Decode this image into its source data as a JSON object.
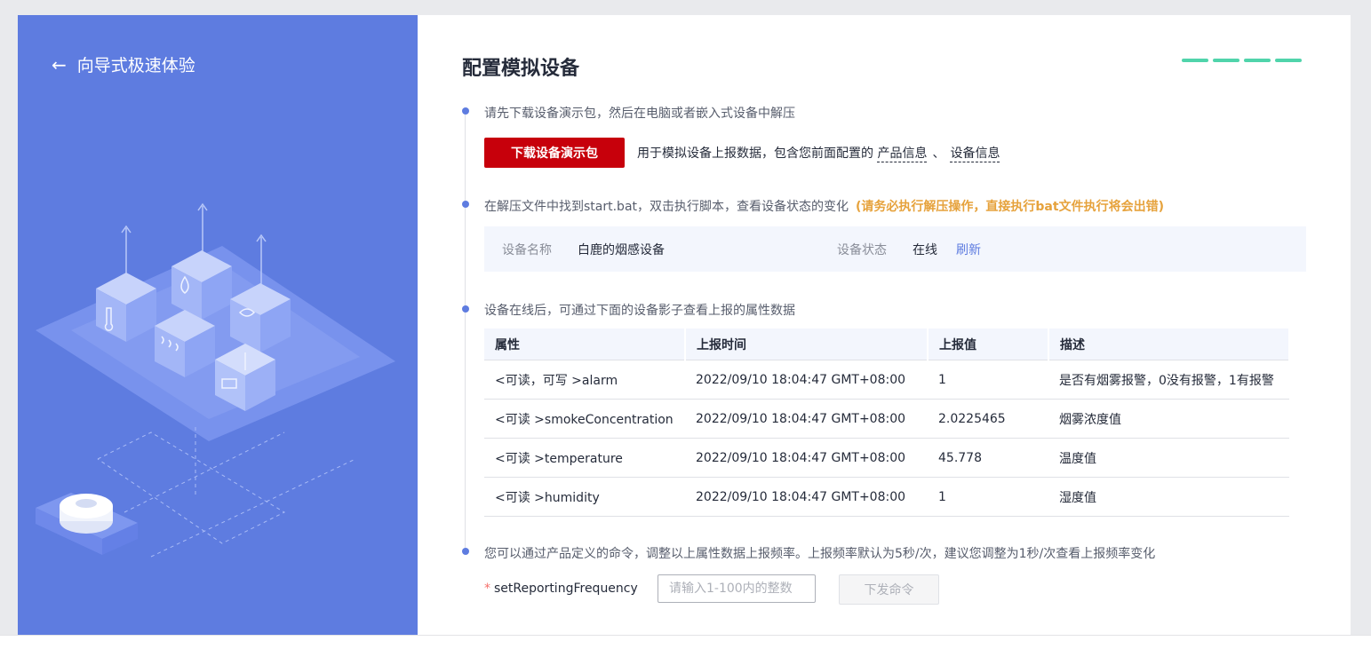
{
  "header": {
    "back_label": "向导式极速体验",
    "title": "配置模拟设备"
  },
  "progress": {
    "total_steps": 4,
    "completed_steps": 4,
    "color": "#50d4ab"
  },
  "steps": {
    "step1": "请先下载设备演示包，然后在电脑或者嵌入式设备中解压",
    "step2": "在解压文件中找到start.bat，双击执行脚本，查看设备状态的变化",
    "step2_warning": "(请务必执行解压操作，直接执行bat文件执行将会出错)",
    "step3": "设备在线后，可通过下面的设备影子查看上报的属性数据",
    "step4": "您可以通过产品定义的命令，调整以上属性数据上报频率。上报频率默认为5秒/次，建议您调整为1秒/次查看上报频率变化"
  },
  "download": {
    "button_label": "下载设备演示包",
    "desc": "用于模拟设备上报数据，包含您前面配置的",
    "link_product": "产品信息",
    "separator": "、",
    "link_device": "设备信息"
  },
  "device": {
    "name_label": "设备名称",
    "name_value": "白鹿的烟感设备",
    "status_label": "设备状态",
    "status_value": "在线",
    "refresh_label": "刷新"
  },
  "table": {
    "headers": [
      "属性",
      "上报时间",
      "上报值",
      "描述"
    ],
    "rows": [
      [
        "<可读，可写 >alarm",
        "2022/09/10 18:04:47 GMT+08:00",
        "1",
        "是否有烟雾报警，0没有报警，1有报警"
      ],
      [
        "<可读 >smokeConcentration",
        "2022/09/10 18:04:47 GMT+08:00",
        "2.0225465",
        "烟雾浓度值"
      ],
      [
        "<可读 >temperature",
        "2022/09/10 18:04:47 GMT+08:00",
        "45.778",
        "温度值"
      ],
      [
        "<可读 >humidity",
        "2022/09/10 18:04:47 GMT+08:00",
        "1",
        "湿度值"
      ]
    ]
  },
  "command": {
    "label": "setReportingFrequency",
    "required_mark": "*",
    "placeholder": "请输入1-100内的整数",
    "value": "",
    "send_label": "下发命令"
  },
  "colors": {
    "left_panel": "#5e7ce0",
    "primary_button": "#c7000b",
    "accent": "#5e7ce0",
    "warning": "#e6a23c"
  }
}
